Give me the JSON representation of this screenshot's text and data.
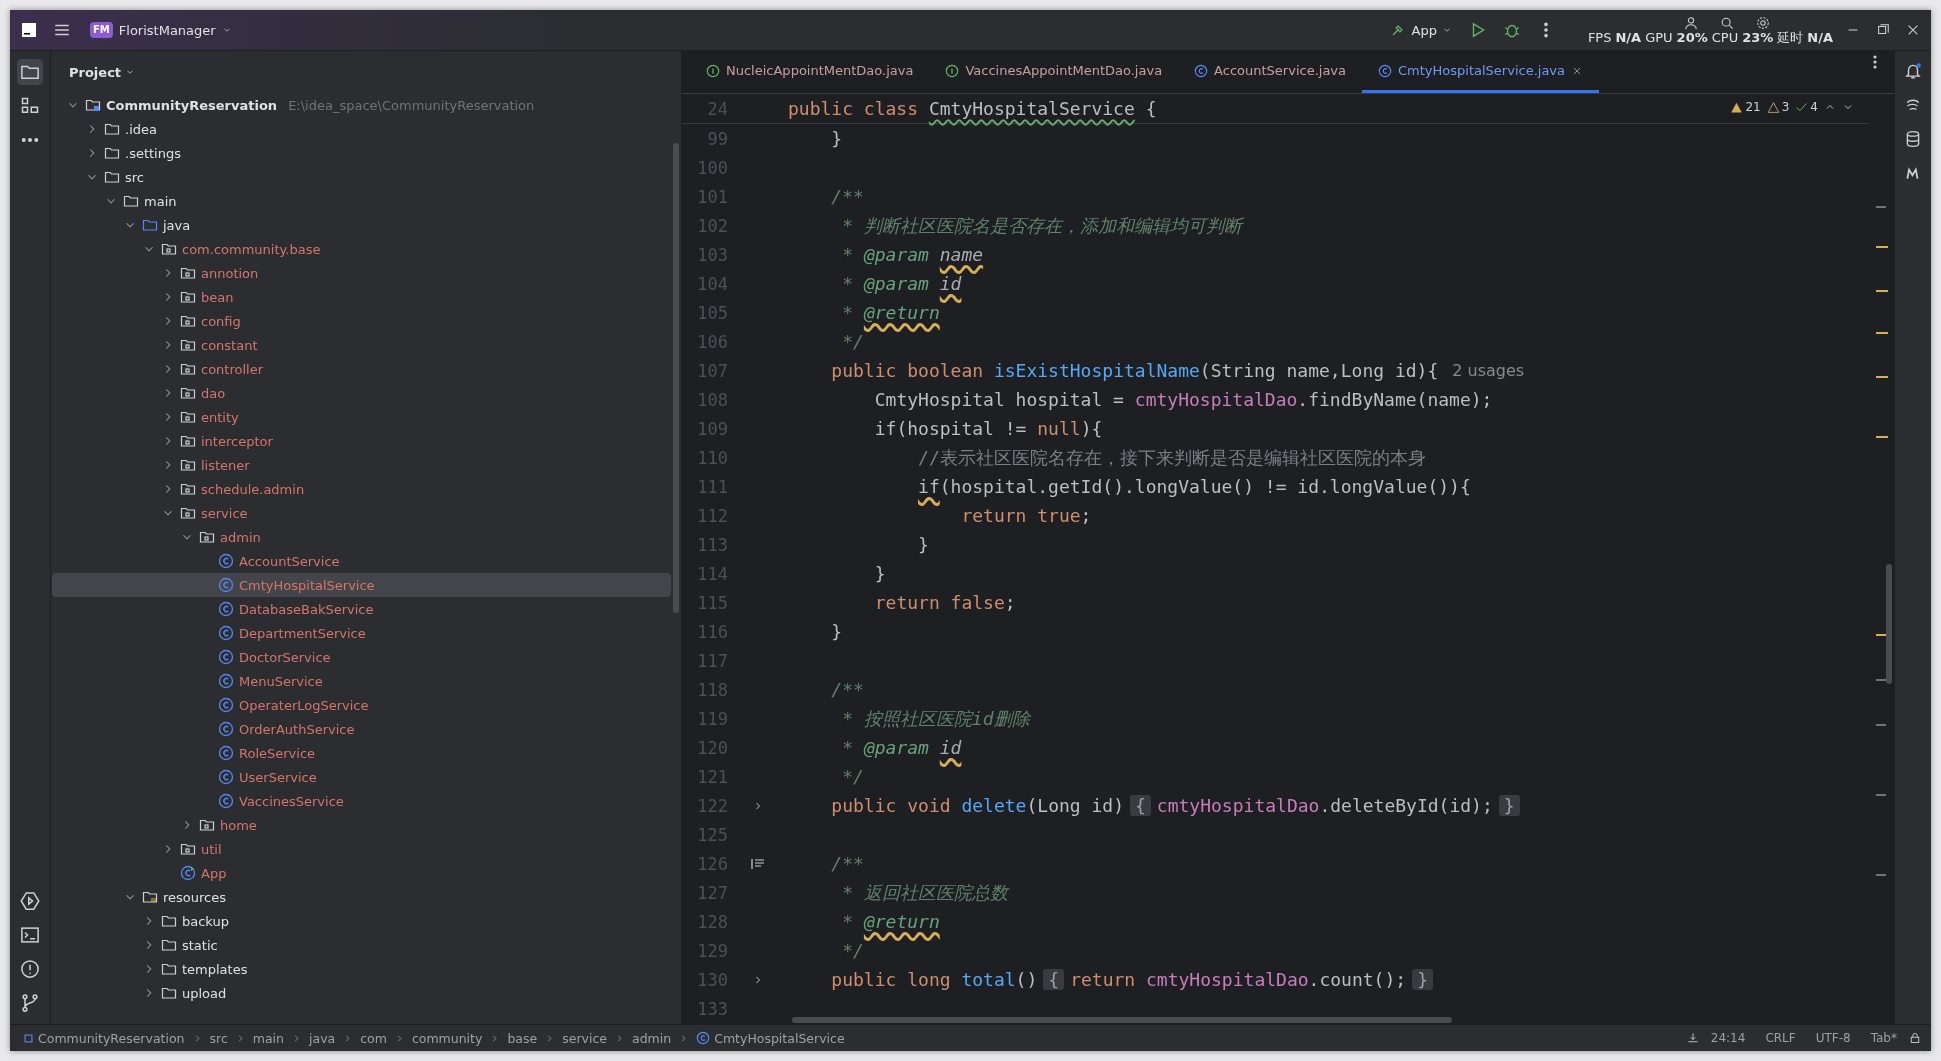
{
  "title_bar": {
    "project_badge": "FM",
    "project_name": "FloristManager",
    "run_config": "App",
    "stats": [
      "FPS",
      "N/A",
      "GPU",
      "20%",
      "CPU",
      "23%",
      "延时",
      "N/A"
    ]
  },
  "project_panel": {
    "title": "Project",
    "tree": [
      {
        "label": "CommunityReservation",
        "path": "E:\\idea_space\\CommunityReservation",
        "kind": "module",
        "expanded": true,
        "selected": false,
        "unversioned": false,
        "children": [
          {
            "label": ".idea",
            "kind": "folder",
            "expanded": false,
            "selected": false,
            "unversioned": false
          },
          {
            "label": ".settings",
            "kind": "folder",
            "expanded": false,
            "selected": false,
            "unversioned": false
          },
          {
            "label": "src",
            "kind": "folder",
            "expanded": true,
            "selected": false,
            "unversioned": false,
            "children": [
              {
                "label": "main",
                "kind": "folder",
                "expanded": true,
                "selected": false,
                "unversioned": false,
                "children": [
                  {
                    "label": "java",
                    "kind": "source",
                    "expanded": true,
                    "selected": false,
                    "unversioned": false,
                    "children": [
                      {
                        "label": "com.community.base",
                        "kind": "package",
                        "expanded": true,
                        "selected": false,
                        "unversioned": true,
                        "children": [
                          {
                            "label": "annotion",
                            "kind": "package",
                            "expanded": false,
                            "selected": false,
                            "unversioned": true
                          },
                          {
                            "label": "bean",
                            "kind": "package",
                            "expanded": false,
                            "selected": false,
                            "unversioned": true
                          },
                          {
                            "label": "config",
                            "kind": "package",
                            "expanded": false,
                            "selected": false,
                            "unversioned": true
                          },
                          {
                            "label": "constant",
                            "kind": "package",
                            "expanded": false,
                            "selected": false,
                            "unversioned": true
                          },
                          {
                            "label": "controller",
                            "kind": "package",
                            "expanded": false,
                            "selected": false,
                            "unversioned": true
                          },
                          {
                            "label": "dao",
                            "kind": "package",
                            "expanded": false,
                            "selected": false,
                            "unversioned": true
                          },
                          {
                            "label": "entity",
                            "kind": "package",
                            "expanded": false,
                            "selected": false,
                            "unversioned": true
                          },
                          {
                            "label": "interceptor",
                            "kind": "package",
                            "expanded": false,
                            "selected": false,
                            "unversioned": true
                          },
                          {
                            "label": "listener",
                            "kind": "package",
                            "expanded": false,
                            "selected": false,
                            "unversioned": true
                          },
                          {
                            "label": "schedule.admin",
                            "kind": "package",
                            "expanded": false,
                            "selected": false,
                            "unversioned": true
                          },
                          {
                            "label": "service",
                            "kind": "package",
                            "expanded": true,
                            "selected": false,
                            "unversioned": true,
                            "children": [
                              {
                                "label": "admin",
                                "kind": "package",
                                "expanded": true,
                                "selected": false,
                                "unversioned": true,
                                "children": [
                                  {
                                    "label": "AccountService",
                                    "kind": "class",
                                    "selected": false,
                                    "unversioned": true
                                  },
                                  {
                                    "label": "CmtyHospitalService",
                                    "kind": "class",
                                    "selected": true,
                                    "unversioned": true
                                  },
                                  {
                                    "label": "DatabaseBakService",
                                    "kind": "class",
                                    "selected": false,
                                    "unversioned": true
                                  },
                                  {
                                    "label": "DepartmentService",
                                    "kind": "class",
                                    "selected": false,
                                    "unversioned": true
                                  },
                                  {
                                    "label": "DoctorService",
                                    "kind": "class",
                                    "selected": false,
                                    "unversioned": true
                                  },
                                  {
                                    "label": "MenuService",
                                    "kind": "class",
                                    "selected": false,
                                    "unversioned": true
                                  },
                                  {
                                    "label": "OperaterLogService",
                                    "kind": "class",
                                    "selected": false,
                                    "unversioned": true
                                  },
                                  {
                                    "label": "OrderAuthService",
                                    "kind": "class",
                                    "selected": false,
                                    "unversioned": true
                                  },
                                  {
                                    "label": "RoleService",
                                    "kind": "class",
                                    "selected": false,
                                    "unversioned": true
                                  },
                                  {
                                    "label": "UserService",
                                    "kind": "class",
                                    "selected": false,
                                    "unversioned": true
                                  },
                                  {
                                    "label": "VaccinesService",
                                    "kind": "class",
                                    "selected": false,
                                    "unversioned": true
                                  }
                                ]
                              },
                              {
                                "label": "home",
                                "kind": "package",
                                "expanded": false,
                                "selected": false,
                                "unversioned": true
                              }
                            ]
                          },
                          {
                            "label": "util",
                            "kind": "package",
                            "expanded": false,
                            "selected": false,
                            "unversioned": true
                          },
                          {
                            "label": "App",
                            "kind": "app",
                            "selected": false,
                            "unversioned": true
                          }
                        ]
                      }
                    ]
                  },
                  {
                    "label": "resources",
                    "kind": "resources",
                    "expanded": true,
                    "selected": false,
                    "unversioned": false,
                    "children": [
                      {
                        "label": "backup",
                        "kind": "folder",
                        "expanded": false,
                        "selected": false,
                        "unversioned": false
                      },
                      {
                        "label": "static",
                        "kind": "folder",
                        "expanded": false,
                        "selected": false,
                        "unversioned": false
                      },
                      {
                        "label": "templates",
                        "kind": "folder",
                        "expanded": false,
                        "selected": false,
                        "unversioned": false
                      },
                      {
                        "label": "upload",
                        "kind": "folder",
                        "expanded": false,
                        "selected": false,
                        "unversioned": false
                      }
                    ]
                  }
                ]
              }
            ]
          }
        ]
      }
    ]
  },
  "tabs": [
    {
      "label": "NucleicAppointMentDao.java",
      "kind": "interface",
      "selected": false
    },
    {
      "label": "VaccinesAppointMentDao.java",
      "kind": "interface",
      "selected": false
    },
    {
      "label": "AccountService.java",
      "kind": "class",
      "selected": false
    },
    {
      "label": "CmtyHospitalService.java",
      "kind": "class",
      "selected": true
    }
  ],
  "inspections": {
    "warnings": "21",
    "weak_warnings": "3",
    "passed": "4"
  },
  "editor": {
    "sticky": {
      "number": "24",
      "tokens": [
        {
          "kind": "keyword",
          "text": "public class "
        },
        {
          "kind": "plain",
          "text": "CmtyHospitalService",
          "typo": true
        },
        {
          "kind": "plain",
          "text": " {"
        }
      ]
    },
    "lines": [
      {
        "number": "99",
        "tokens": [
          {
            "kind": "plain",
            "text": "    }"
          }
        ]
      },
      {
        "number": "100"
      },
      {
        "number": "101",
        "tokens": [
          {
            "kind": "doc",
            "text": "    /**"
          }
        ]
      },
      {
        "number": "102",
        "tokens": [
          {
            "kind": "doc",
            "text": "     * 判断社区医院名是否存在，添加和编辑均可判断"
          }
        ]
      },
      {
        "number": "103",
        "tokens": [
          {
            "kind": "doc",
            "text": "     * "
          },
          {
            "kind": "doc_tag",
            "text": "@param "
          },
          {
            "kind": "doc_param",
            "text": "name",
            "warned": true
          }
        ]
      },
      {
        "number": "104",
        "tokens": [
          {
            "kind": "doc",
            "text": "     * "
          },
          {
            "kind": "doc_tag",
            "text": "@param "
          },
          {
            "kind": "doc_param",
            "text": "id",
            "warned": true
          }
        ]
      },
      {
        "number": "105",
        "tokens": [
          {
            "kind": "doc",
            "text": "     * "
          },
          {
            "kind": "doc_tag",
            "text": "@return",
            "warned": true
          }
        ]
      },
      {
        "number": "106",
        "tokens": [
          {
            "kind": "doc",
            "text": "     */"
          }
        ]
      },
      {
        "number": "107",
        "tokens": [
          {
            "kind": "keyword",
            "text": "    public boolean "
          },
          {
            "kind": "method",
            "text": "isExistHospitalName"
          },
          {
            "kind": "plain",
            "text": "(String name,Long id){"
          }
        ],
        "hint": "2 usages"
      },
      {
        "number": "108",
        "tokens": [
          {
            "kind": "plain",
            "text": "        CmtyHospital hospital = "
          },
          {
            "kind": "field",
            "text": "cmtyHospitalDao"
          },
          {
            "kind": "plain",
            "text": ".findByName(name);"
          }
        ]
      },
      {
        "number": "109",
        "tokens": [
          {
            "kind": "plain",
            "text": "        if(hospital != "
          },
          {
            "kind": "keyword",
            "text": "null"
          },
          {
            "kind": "plain",
            "text": "){"
          }
        ]
      },
      {
        "number": "110",
        "tokens": [
          {
            "kind": "comment",
            "text": "            //表示社区医院名存在，接下来判断是否是编辑社区医院的本身"
          }
        ]
      },
      {
        "number": "111",
        "tokens": [
          {
            "kind": "plain",
            "text": "            if",
            "warned": true
          },
          {
            "kind": "plain",
            "text": "(hospital.getId().longValue() != id.longValue()){"
          }
        ]
      },
      {
        "number": "112",
        "tokens": [
          {
            "kind": "keyword",
            "text": "                return true"
          },
          {
            "kind": "plain",
            "text": ";"
          }
        ]
      },
      {
        "number": "113",
        "tokens": [
          {
            "kind": "plain",
            "text": "            }"
          }
        ]
      },
      {
        "number": "114",
        "tokens": [
          {
            "kind": "plain",
            "text": "        }"
          }
        ]
      },
      {
        "number": "115",
        "tokens": [
          {
            "kind": "keyword",
            "text": "        return false"
          },
          {
            "kind": "plain",
            "text": ";"
          }
        ]
      },
      {
        "number": "116",
        "tokens": [
          {
            "kind": "plain",
            "text": "    }"
          }
        ]
      },
      {
        "number": "117"
      },
      {
        "number": "118",
        "tokens": [
          {
            "kind": "doc",
            "text": "    /**"
          }
        ]
      },
      {
        "number": "119",
        "tokens": [
          {
            "kind": "doc",
            "text": "     * 按照社区医院id删除"
          }
        ]
      },
      {
        "number": "120",
        "tokens": [
          {
            "kind": "doc",
            "text": "     * "
          },
          {
            "kind": "doc_tag",
            "text": "@param "
          },
          {
            "kind": "doc_param",
            "text": "id",
            "warned": true
          }
        ]
      },
      {
        "number": "121",
        "tokens": [
          {
            "kind": "doc",
            "text": "     */"
          }
        ]
      },
      {
        "number": "122",
        "foldable": true,
        "tokens": [
          {
            "kind": "keyword",
            "text": "    public void "
          },
          {
            "kind": "method",
            "text": "delete"
          },
          {
            "kind": "plain",
            "text": "(Long id)"
          },
          {
            "kind": "fold",
            "text": "{"
          },
          {
            "kind": "field",
            "text": "cmtyHospitalDao"
          },
          {
            "kind": "plain",
            "text": ".deleteById(id);"
          },
          {
            "kind": "fold",
            "text": "}"
          }
        ]
      },
      {
        "number": "125"
      },
      {
        "number": "126",
        "doc_toggle": true,
        "tokens": [
          {
            "kind": "doc",
            "text": "    /**"
          }
        ]
      },
      {
        "number": "127",
        "tokens": [
          {
            "kind": "doc",
            "text": "     * 返回社区医院总数"
          }
        ]
      },
      {
        "number": "128",
        "tokens": [
          {
            "kind": "doc",
            "text": "     * "
          },
          {
            "kind": "doc_tag",
            "text": "@return",
            "warned": true
          }
        ]
      },
      {
        "number": "129",
        "tokens": [
          {
            "kind": "doc",
            "text": "     */"
          }
        ]
      },
      {
        "number": "130",
        "foldable": true,
        "tokens": [
          {
            "kind": "keyword",
            "text": "    public long "
          },
          {
            "kind": "method",
            "text": "total"
          },
          {
            "kind": "plain",
            "text": "()"
          },
          {
            "kind": "fold",
            "text": "{"
          },
          {
            "kind": "keyword",
            "text": "return "
          },
          {
            "kind": "field",
            "text": "cmtyHospitalDao"
          },
          {
            "kind": "plain",
            "text": ".count();"
          },
          {
            "kind": "fold",
            "text": "}"
          }
        ]
      },
      {
        "number": "133"
      }
    ]
  },
  "breadcrumbs": [
    {
      "label": "CommunityReservation",
      "kind": "module"
    },
    {
      "label": "src",
      "kind": "folder"
    },
    {
      "label": "main",
      "kind": "folder"
    },
    {
      "label": "java",
      "kind": "folder"
    },
    {
      "label": "com",
      "kind": "folder"
    },
    {
      "label": "community",
      "kind": "folder"
    },
    {
      "label": "base",
      "kind": "folder"
    },
    {
      "label": "service",
      "kind": "folder"
    },
    {
      "label": "admin",
      "kind": "folder"
    },
    {
      "label": "CmtyHospitalService",
      "kind": "class"
    }
  ],
  "status_bar": {
    "position": "24:14",
    "line_separator": "CRLF",
    "encoding": "UTF-8",
    "indent": "Tab*"
  }
}
